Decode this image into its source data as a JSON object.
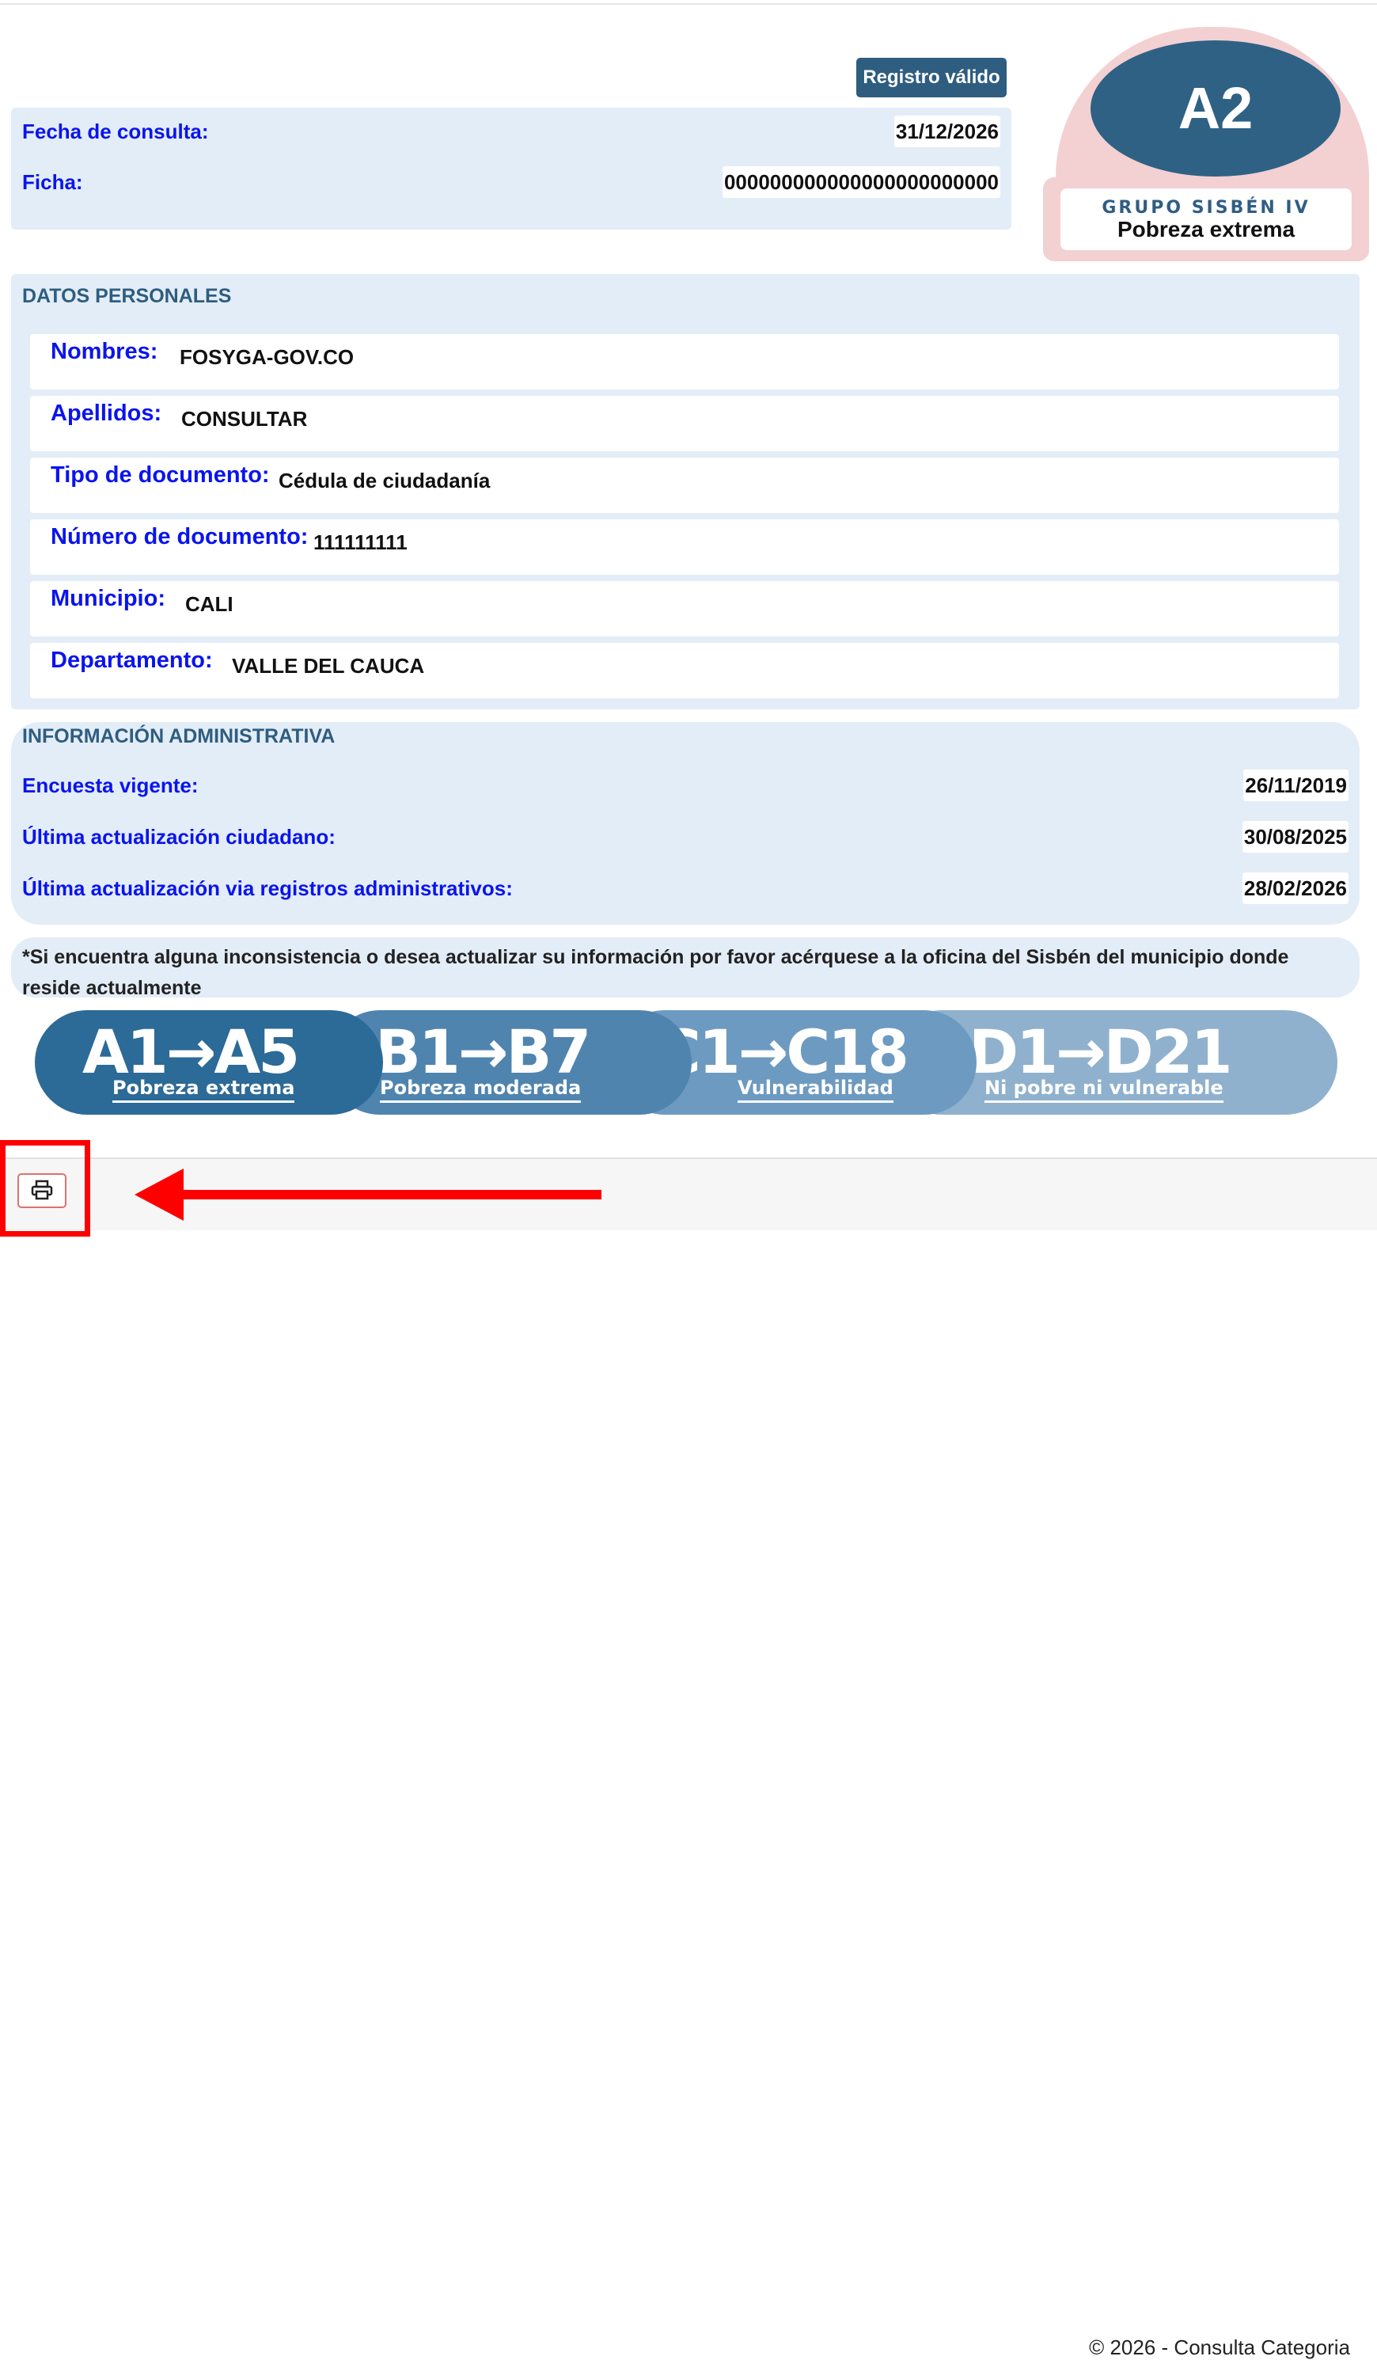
{
  "status_badge": "Registro válido",
  "consulta": {
    "fecha_label": "Fecha de consulta:",
    "fecha_value": "31/12/2026",
    "ficha_label": "Ficha:",
    "ficha_value": "000000000000000000000000"
  },
  "group": {
    "code": "A2",
    "label": "GRUPO SISBÉN IV",
    "name": "Pobreza extrema"
  },
  "datos_personales": {
    "title": "DATOS PERSONALES",
    "fields": [
      {
        "label": "Nombres:",
        "value": "FOSYGA-GOV.CO"
      },
      {
        "label": "Apellidos:",
        "value": "CONSULTAR"
      },
      {
        "label": "Tipo de documento:",
        "value": "Cédula de ciudadanía"
      },
      {
        "label": "Número de documento:",
        "value": "111111111"
      },
      {
        "label": "Municipio:",
        "value": "CALI"
      },
      {
        "label": "Departamento:",
        "value": "VALLE DEL CAUCA"
      }
    ]
  },
  "info_admin": {
    "title": "INFORMACIÓN ADMINISTRATIVA",
    "rows": [
      {
        "label": "Encuesta vigente:",
        "value": "26/11/2019"
      },
      {
        "label": "Última actualización ciudadano:",
        "value": "30/08/2025"
      },
      {
        "label": "Última actualización via registros administrativos:",
        "value": "28/02/2026"
      }
    ]
  },
  "note": "*Si encuentra alguna inconsistencia o desea actualizar su información por favor acérquese a la oficina del Sisbén del municipio donde reside actualmente",
  "scale": [
    {
      "code": "A1→A5",
      "desc": "Pobreza extrema"
    },
    {
      "code": "B1→B7",
      "desc": "Pobreza moderada"
    },
    {
      "code": "C1→C18",
      "desc": "Vulnerabilidad"
    },
    {
      "code": "D1→D21",
      "desc": "Ni pobre ni vulnerable"
    }
  ],
  "footer": {
    "copyright": "© 2026 - Consulta Categoria",
    "print_icon": "printer-icon"
  },
  "colors": {
    "accent": "#2e5d7f",
    "label_blue": "#0a14ee",
    "panel_bg": "#e3edf7",
    "highlight_red": "#ff0000"
  }
}
